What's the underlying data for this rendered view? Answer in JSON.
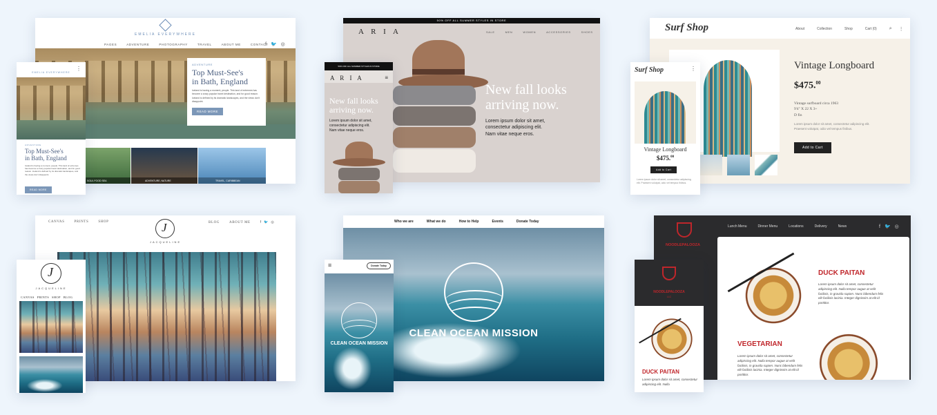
{
  "cards": {
    "emelia": {
      "logo": "EMELIA EVERYWHERE",
      "nav": [
        "PAGES",
        "ADVENTURE",
        "PHOTOGRAPHY",
        "TRAVEL",
        "ABOUT ME",
        "CONTACT"
      ],
      "kicker": "ADVENTURE",
      "title_line1": "Top Must-See's",
      "title_line2": "in Bath, England",
      "body": "Iceland is having a moment, people. This land of extremes has become a crazy popular travel destination, and for good reason. Iceland is defined by its dramatic landscapes, and the views don't disappoint.",
      "button": "READ MORE",
      "thumbs": [
        "SOUL FOOD SEA",
        "ADVENTURE, NATURE",
        "TRAVEL, CARIBBEAN"
      ],
      "mobile_logo": "EMELIA EVERYWHERE",
      "mobile_kicker": "ADVENTURE",
      "mobile_body": "Iceland is having a moment, people. This land of extremes has become a crazy popular travel destination, and for good reason. Iceland is defined by its dramatic landscapes, and the views don't disappoint.",
      "mobile_button": "READ MORE"
    },
    "aria": {
      "banner": "50% OFF ALL SUMMER STYLES IN STORE",
      "logo": "A R I A",
      "nav": [
        "SALE",
        "MEN",
        "WOMEN",
        "ACCESSORIES",
        "SHOES"
      ],
      "headline_line1": "New fall looks",
      "headline_line2": "arriving now.",
      "body_line1": "Lorem ipsum dolor sit amet,",
      "body_line2": "consectetur adipiscing elit.",
      "body_line3": "Nam vitae neque eros.",
      "mobile_banner": "50% OFF ALL SUMMER STYLES IN STORE",
      "mobile_logo": "A R I A"
    },
    "surf": {
      "logo": "Surf Shop",
      "nav": [
        "About",
        "Collection",
        "Shop",
        "Cart (0)"
      ],
      "product": "Vintage Longboard",
      "price": "$475.",
      "price_cents": "00",
      "desc_line1": "Vintage surfboard circa 1963",
      "desc_line2": "9'4\" X 22 X 3+",
      "desc_line3": "D fin",
      "lorem": "Lorem ipsum dolor sit amet, consectetur adipiscing elit. Praesent volutpat, odio vel tempus finibus.",
      "button": "Add to Cart",
      "mobile_button": "Add to Cart"
    },
    "jacqueline": {
      "nav_left": [
        "CANVAS",
        "PRINTS",
        "SHOP"
      ],
      "nav_right": [
        "BLOG",
        "ABOUT ME"
      ],
      "logo_letter": "J",
      "logo_name": "JACQUELINE",
      "mobile_nav": [
        "CANVAS",
        "PRINTS",
        "SHOP",
        "BLOG"
      ]
    },
    "ocean": {
      "nav": [
        "Who we are",
        "What we do",
        "How to Help",
        "Events",
        "Donate Today"
      ],
      "title": "CLEAN OCEAN MISSION",
      "mobile_button": "Donate Today",
      "mobile_title": "CLEAN OCEAN MISSION"
    },
    "noodle": {
      "nav": [
        "Lunch Menu",
        "Dinner Menu",
        "Locations",
        "Delivery",
        "News"
      ],
      "brand": "NOODLEPALOOZA",
      "brand_sub": "LLC",
      "dish1": "DUCK PAITAN",
      "dish2": "VEGETARIAN",
      "dish_body": "Lorem ipsum dolor sit amet, consectetur adipiscing elit. Nulla tempor augue at velit facilisis, in gravida sapien. Nunc bibendum felis elit facilisis lacinia. Integer dignissim at elit id porttitor.",
      "mobile_dish": "DUCK PAITAN",
      "mobile_body": "Lorem ipsum dolor sit amet, consectetur adipiscing elit. Nulla"
    }
  },
  "colors": {
    "background": "#eef5fc",
    "noodle_red": "#c0262b",
    "steel_blue": "#6e8fb8"
  }
}
